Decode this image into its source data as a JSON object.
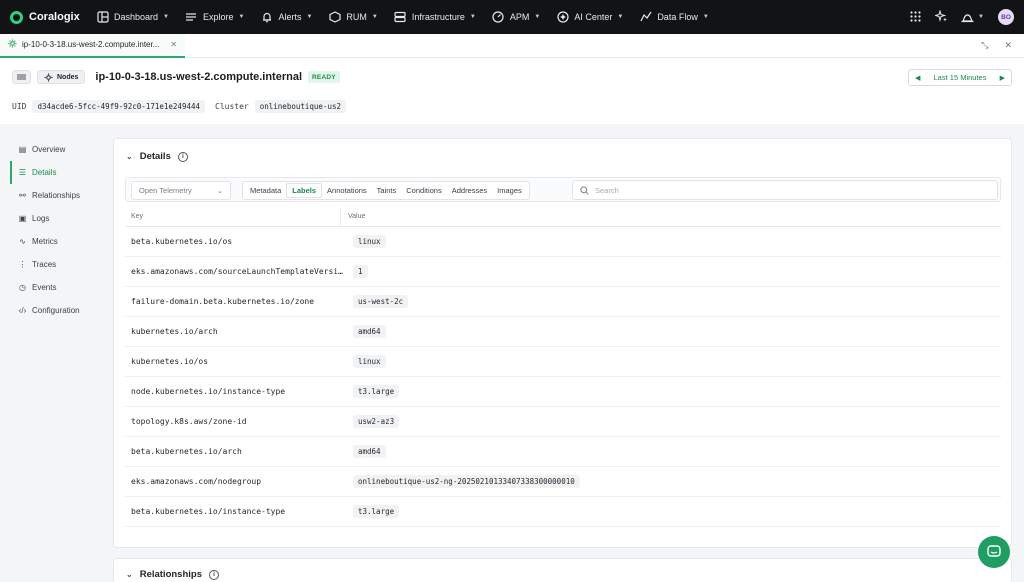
{
  "brand": {
    "name": "Coralogix"
  },
  "nav": [
    {
      "label": "Dashboard",
      "icon": "dashboard-icon"
    },
    {
      "label": "Explore",
      "icon": "explore-icon"
    },
    {
      "label": "Alerts",
      "icon": "bell-icon"
    },
    {
      "label": "RUM",
      "icon": "rum-icon"
    },
    {
      "label": "Infrastructure",
      "icon": "infrastructure-icon"
    },
    {
      "label": "APM",
      "icon": "gauge-icon"
    },
    {
      "label": "AI Center",
      "icon": "ai-center-icon"
    },
    {
      "label": "Data Flow",
      "icon": "data-flow-icon"
    }
  ],
  "user": {
    "initials": "BO"
  },
  "tab": {
    "label": "ip-10-0-3-18.us-west-2.compute.inter..."
  },
  "header": {
    "type_label": "Nodes",
    "host": "ip-10-0-3-18.us-west-2.compute.internal",
    "status": "READY",
    "time_range": "Last 15 Minutes",
    "uid_label": "UID",
    "uid": "d34acde6-5fcc-49f9-92c0-171e1e249444",
    "cluster_label": "Cluster",
    "cluster": "onlineboutique-us2"
  },
  "sidebar": {
    "items": [
      {
        "label": "Overview",
        "icon": "overview-icon"
      },
      {
        "label": "Details",
        "icon": "list-icon",
        "active": true
      },
      {
        "label": "Relationships",
        "icon": "relationships-icon"
      },
      {
        "label": "Logs",
        "icon": "logs-icon"
      },
      {
        "label": "Metrics",
        "icon": "metrics-icon"
      },
      {
        "label": "Traces",
        "icon": "traces-icon"
      },
      {
        "label": "Events",
        "icon": "events-icon"
      },
      {
        "label": "Configuration",
        "icon": "code-icon"
      }
    ]
  },
  "details": {
    "title": "Details",
    "source": "Open Telemetry",
    "subtabs": [
      "Metadata",
      "Labels",
      "Annotations",
      "Taints",
      "Conditions",
      "Addresses",
      "Images"
    ],
    "active_subtab": "Labels",
    "search_placeholder": "Search",
    "columns": {
      "key": "Key",
      "value": "Value"
    },
    "rows": [
      {
        "key": "beta.kubernetes.io/os",
        "value": "linux"
      },
      {
        "key": "eks.amazonaws.com/sourceLaunchTemplateVersi...",
        "value": "1"
      },
      {
        "key": "failure-domain.beta.kubernetes.io/zone",
        "value": "us-west-2c"
      },
      {
        "key": "kubernetes.io/arch",
        "value": "amd64"
      },
      {
        "key": "kubernetes.io/os",
        "value": "linux"
      },
      {
        "key": "node.kubernetes.io/instance-type",
        "value": "t3.large"
      },
      {
        "key": "topology.k8s.aws/zone-id",
        "value": "usw2-az3"
      },
      {
        "key": "beta.kubernetes.io/arch",
        "value": "amd64"
      },
      {
        "key": "eks.amazonaws.com/nodegroup",
        "value": "onlineboutique-us2-ng-20250210133407338300000010"
      },
      {
        "key": "beta.kubernetes.io/instance-type",
        "value": "t3.large"
      }
    ]
  },
  "relationships": {
    "title": "Relationships"
  },
  "colors": {
    "accent": "#1d8a4d",
    "nav_bg": "#121315",
    "brand": "#2fd17e"
  }
}
